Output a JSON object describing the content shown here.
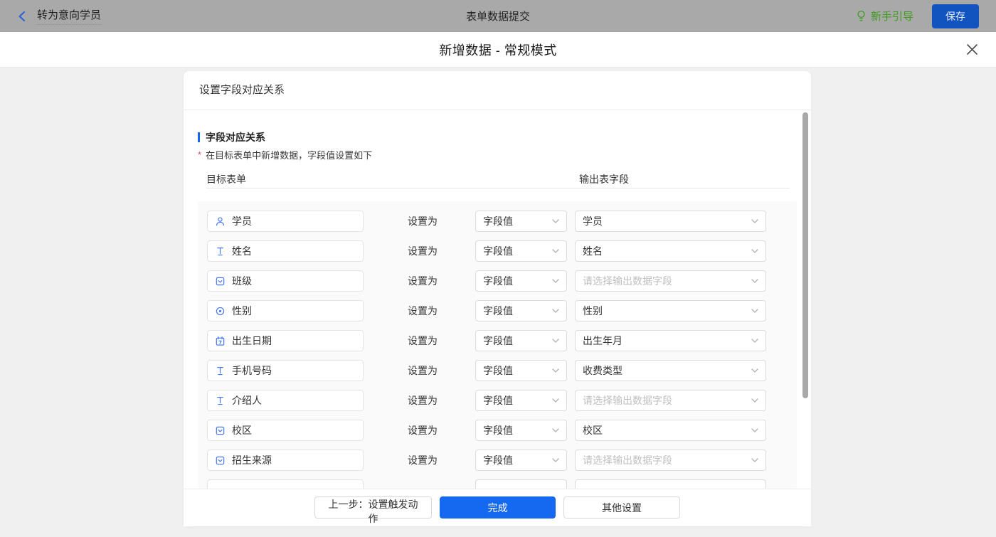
{
  "topbar": {
    "back_label": "转为意向学员",
    "title": "表单数据提交",
    "guide_label": "新手引导",
    "save_label": "保存"
  },
  "modal": {
    "title": "新增数据 - 常规模式"
  },
  "panel": {
    "header": "设置字段对应关系",
    "section_title": "字段对应关系",
    "note_mark": "*",
    "note": "在目标表单中新增数据，字段值设置如下",
    "col_left": "目标表单",
    "col_right": "输出表字段",
    "set_as_label": "设置为",
    "rows": [
      {
        "field": "学员",
        "icon": "person-icon",
        "mode": "字段值",
        "output": "学员",
        "placeholder": false
      },
      {
        "field": "姓名",
        "icon": "text-input-icon",
        "mode": "字段值",
        "output": "姓名",
        "placeholder": false
      },
      {
        "field": "班级",
        "icon": "select-icon",
        "mode": "字段值",
        "output": "请选择输出数据字段",
        "placeholder": true
      },
      {
        "field": "性别",
        "icon": "radio-icon",
        "mode": "字段值",
        "output": "性别",
        "placeholder": false
      },
      {
        "field": "出生日期",
        "icon": "date-icon",
        "mode": "字段值",
        "output": "出生年月",
        "placeholder": false
      },
      {
        "field": "手机号码",
        "icon": "text-input-icon",
        "mode": "字段值",
        "output": "收费类型",
        "placeholder": false
      },
      {
        "field": "介绍人",
        "icon": "text-input-icon",
        "mode": "字段值",
        "output": "请选择输出数据字段",
        "placeholder": true
      },
      {
        "field": "校区",
        "icon": "select-icon",
        "mode": "字段值",
        "output": "校区",
        "placeholder": false
      },
      {
        "field": "招生来源",
        "icon": "select-icon",
        "mode": "字段值",
        "output": "请选择输出数据字段",
        "placeholder": true
      },
      {
        "field": "",
        "icon": "",
        "mode": "",
        "output": "",
        "placeholder": true,
        "partial": true
      }
    ],
    "footer": {
      "prev_label": "上一步：设置触发动作",
      "done_label": "完成",
      "other_label": "其他设置"
    }
  },
  "colors": {
    "primary_blue": "#1569f0",
    "guide_green": "#3f9b1f",
    "topbar_dimmed": "#a9a9a9",
    "icon_blue": "#4a7bf2",
    "placeholder_gray": "#bfbfbf"
  }
}
